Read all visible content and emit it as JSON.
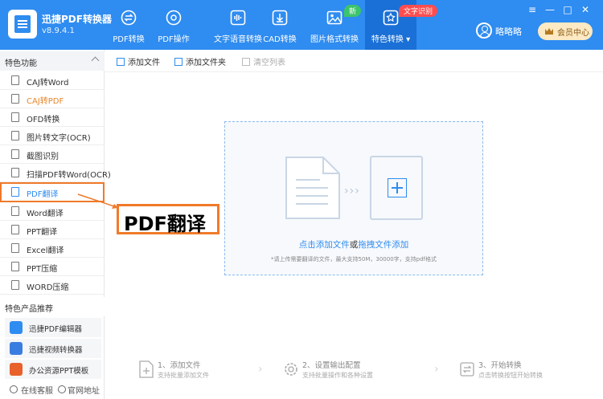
{
  "app": {
    "title": "迅捷PDF转换器",
    "version": "v8.9.4.1"
  },
  "nav": [
    {
      "label": "PDF转换",
      "icon": "pdf-convert-icon"
    },
    {
      "label": "PDF操作",
      "icon": "pdf-operate-icon"
    },
    {
      "label": "文字语音转换",
      "icon": "audio-wave-icon"
    },
    {
      "label": "CAD转换",
      "icon": "cad-download-icon"
    },
    {
      "label": "图片格式转换",
      "icon": "image-icon",
      "badge": "新"
    },
    {
      "label": "特色转换",
      "icon": "special-convert-icon",
      "badge": "文字识别",
      "active": true
    }
  ],
  "user": {
    "name": "略略略"
  },
  "vip": {
    "label": "会员中心"
  },
  "window_controls": [
    "≡",
    "—",
    "□",
    "✕"
  ],
  "sidebar": {
    "section1": "特色功能",
    "items": [
      {
        "label": "CAJ转Word"
      },
      {
        "label": "CAJ转PDF",
        "color": "#e8862a"
      },
      {
        "label": "OFD转换"
      },
      {
        "label": "图片转文字(OCR)"
      },
      {
        "label": "截图识别"
      },
      {
        "label": "扫描PDF转Word(OCR)"
      },
      {
        "label": "PDF翻译",
        "selected": true
      },
      {
        "label": "Word翻译"
      },
      {
        "label": "PPT翻译"
      },
      {
        "label": "Excel翻译"
      },
      {
        "label": "PPT压缩"
      },
      {
        "label": "WORD压缩"
      }
    ],
    "section2": "特色产品推荐",
    "products": [
      {
        "label": "迅捷PDF编辑器",
        "color": "#2f8cf0"
      },
      {
        "label": "迅捷视频转换器",
        "color": "#3a7de0"
      },
      {
        "label": "办公资源PPT模板",
        "color": "#e8612a"
      }
    ],
    "footer": {
      "service": "在线客服",
      "website": "官网地址"
    }
  },
  "toolbar": {
    "add_file": "添加文件",
    "add_folder": "添加文件夹",
    "clear": "清空列表"
  },
  "dropzone": {
    "click_add": "点击添加文件",
    "or": "或",
    "drag_add": "拖拽文件添加",
    "hint": "*请上传需要翻译的文件，最大支持50M，30000字，支持pdf格式"
  },
  "steps": [
    {
      "title": "1、添加文件",
      "desc": "支持批量添加文件"
    },
    {
      "title": "2、设置输出配置",
      "desc": "支持批量操作和各种设置"
    },
    {
      "title": "3、开始转换",
      "desc": "点击转换按钮开始转换"
    }
  ],
  "callout": {
    "text": "PDF翻译"
  },
  "colors": {
    "primary": "#2f8cf0",
    "accent": "#f07a2a",
    "new_badge": "#3cc46b",
    "ocr_badge": "#ff4d4f"
  }
}
